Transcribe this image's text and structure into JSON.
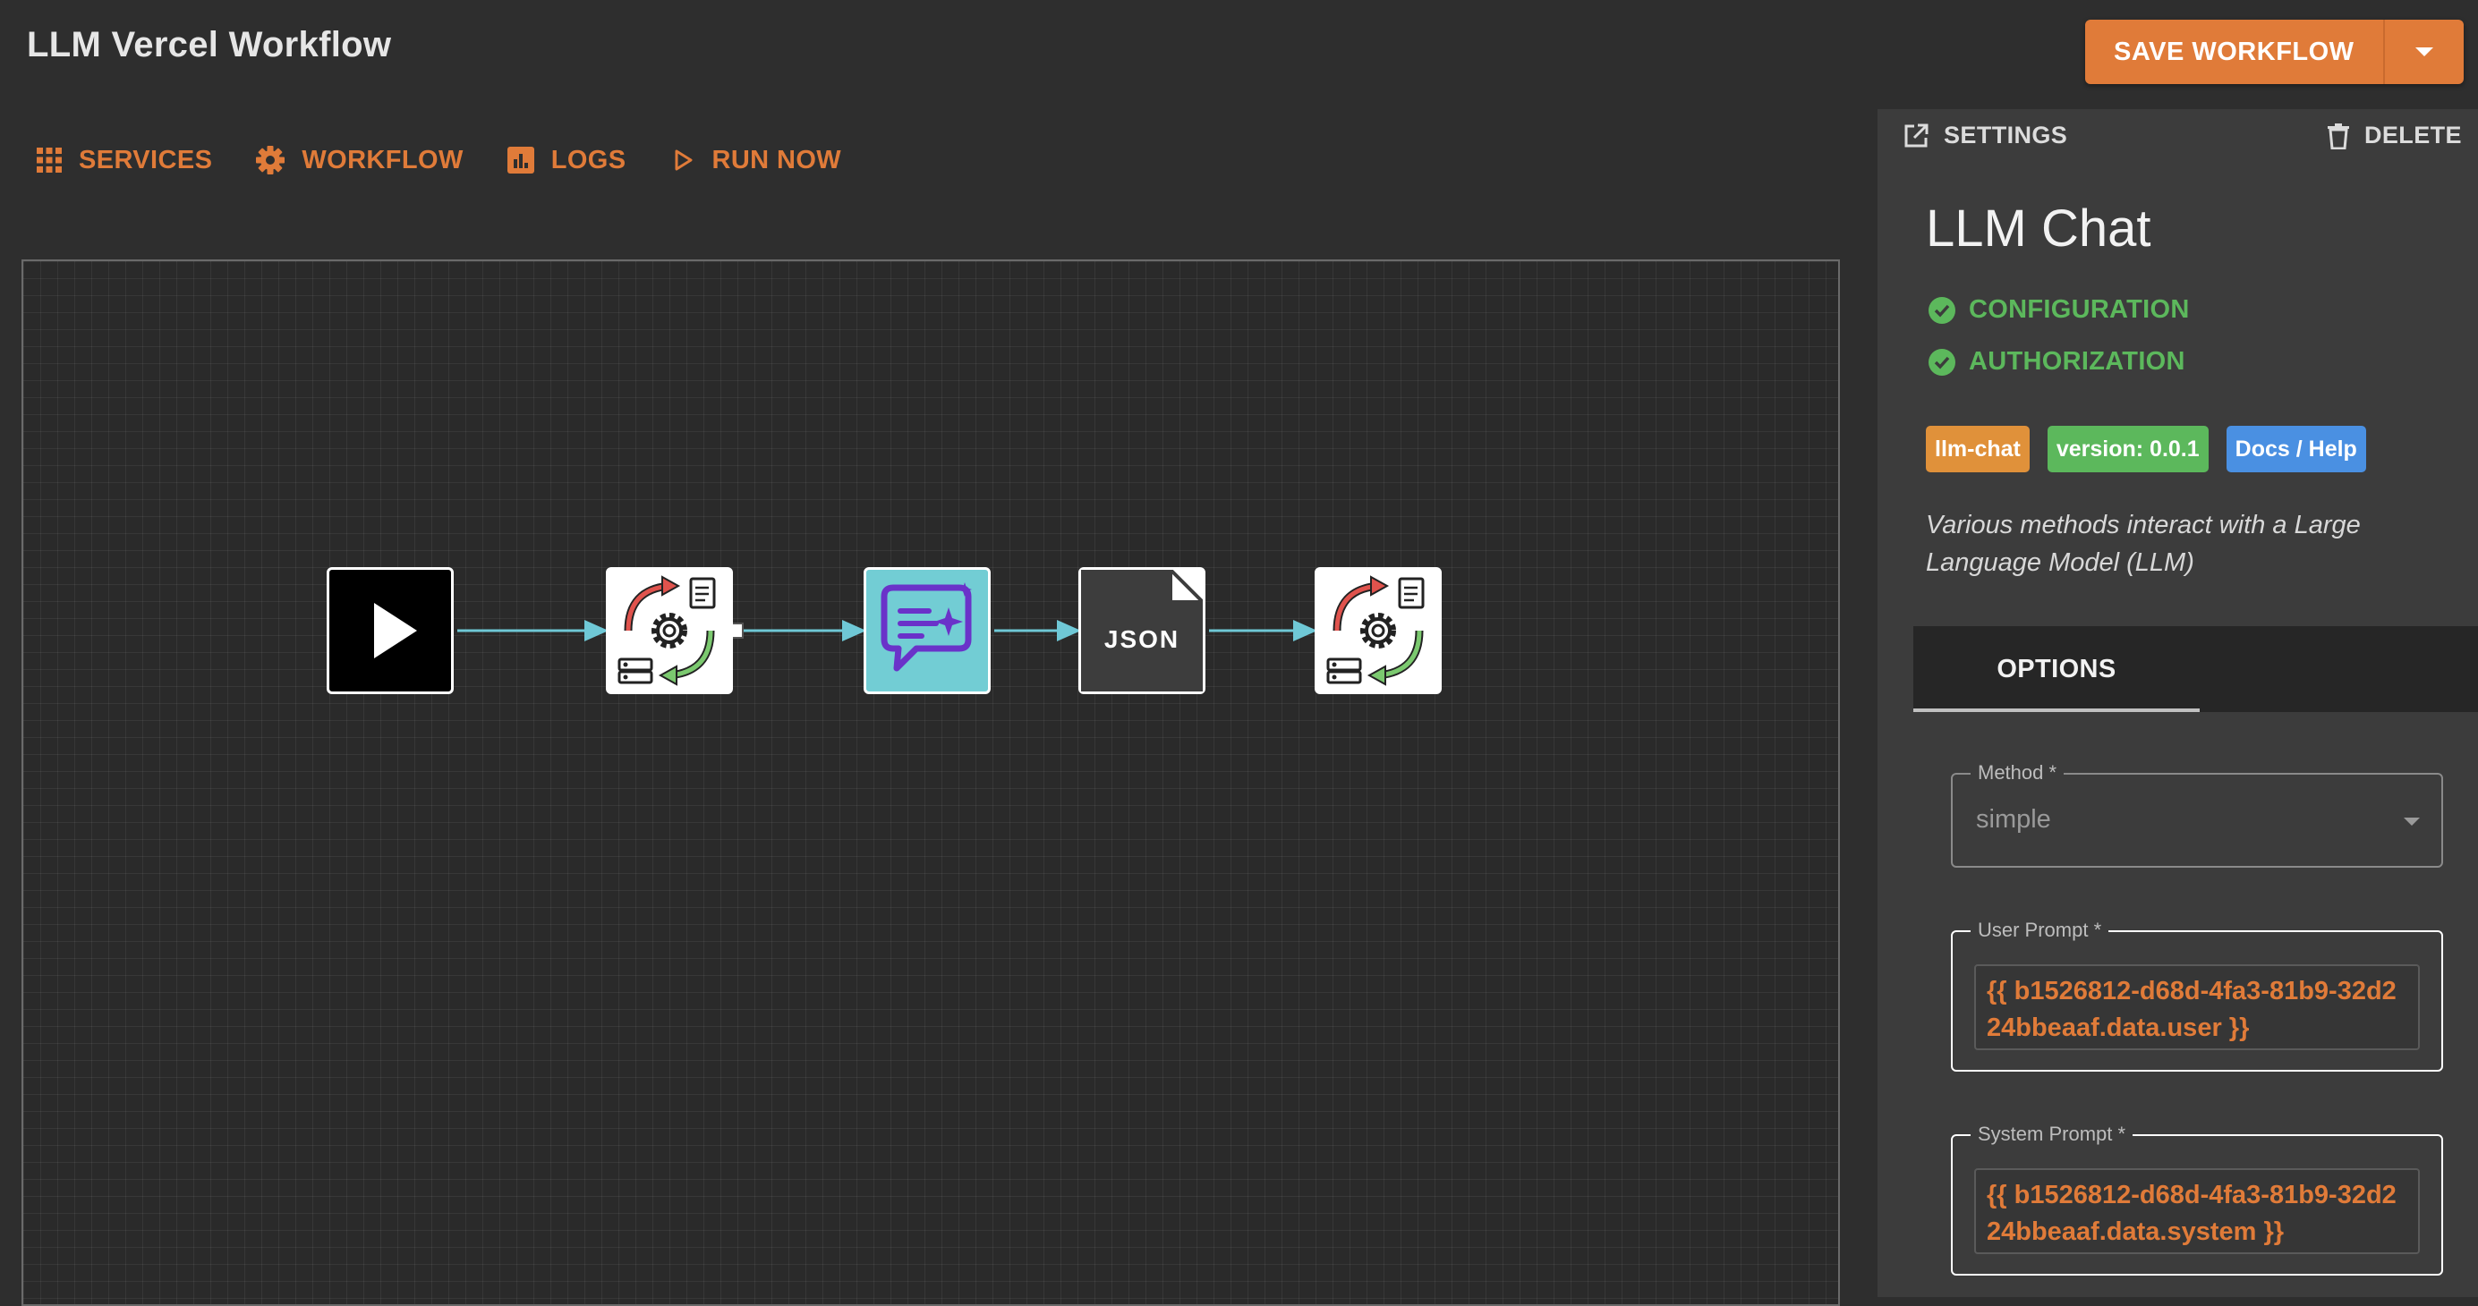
{
  "header": {
    "title": "LLM Vercel Workflow",
    "save_label": "SAVE WORKFLOW"
  },
  "toolbar": {
    "services": "SERVICES",
    "workflow": "WORKFLOW",
    "logs": "LOGS",
    "run_now": "RUN NOW"
  },
  "canvas": {
    "nodes": [
      {
        "name": "start-node",
        "icon": "play-icon"
      },
      {
        "name": "transform-node",
        "icon": "data-transform-icon"
      },
      {
        "name": "llm-chat-node",
        "icon": "ai-chat-icon"
      },
      {
        "name": "json-node",
        "icon": "json-file-icon"
      },
      {
        "name": "transform-node-2",
        "icon": "data-transform-icon"
      }
    ],
    "json_label": "JSON",
    "wire_color": "#6fc8d6"
  },
  "panel": {
    "settings": "SETTINGS",
    "delete": "DELETE",
    "node_title": "LLM Chat",
    "checks": [
      "CONFIGURATION",
      "AUTHORIZATION"
    ],
    "badges": [
      {
        "label": "llm-chat",
        "color": "#e0913a"
      },
      {
        "label": "version: 0.0.1",
        "color": "#5cb85c"
      },
      {
        "label": "Docs / Help",
        "color": "#4a90e2"
      }
    ],
    "description": "Various methods interact with a Large Language Model (LLM)",
    "tab": "OPTIONS",
    "method": {
      "label": "Method *",
      "value": "simple"
    },
    "user_prompt": {
      "label": "User Prompt *",
      "value": "{{ b1526812-d68d-4fa3-81b9-32d224bbeaaf.data.user }}"
    },
    "system_prompt": {
      "label": "System Prompt *",
      "value": "{{ b1526812-d68d-4fa3-81b9-32d224bbeaaf.data.system }}"
    }
  },
  "colors": {
    "accent": "#e07b39",
    "success": "#5cb85c",
    "link": "#4a90e2"
  }
}
